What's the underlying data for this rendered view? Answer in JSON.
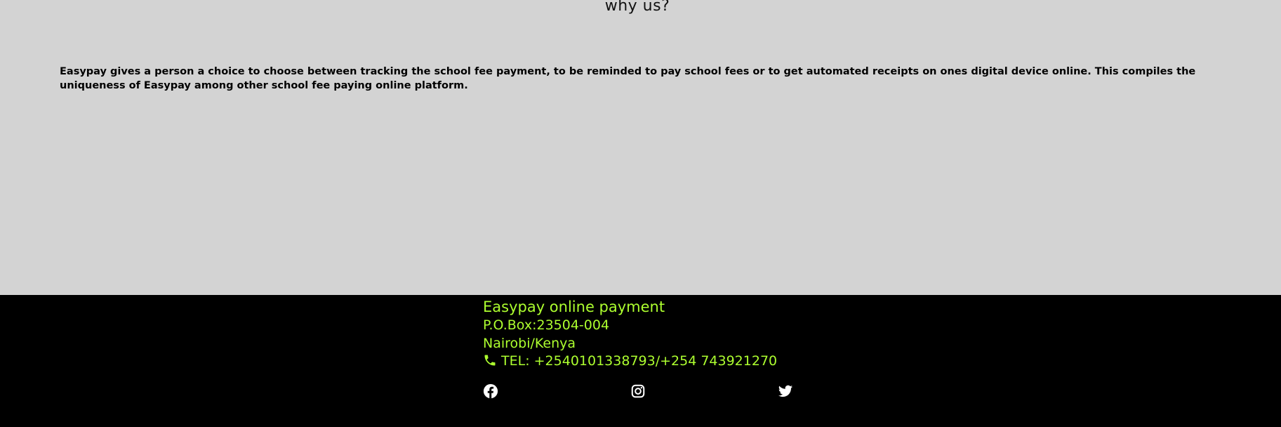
{
  "why": {
    "title": "why us?",
    "text": "Easypay gives a person a choice to choose between tracking the school fee payment, to be reminded to pay school fees or to get automated receipts on ones digital device online. This compiles the uniqueness of Easypay among other school fee paying online platform."
  },
  "footer": {
    "title": "Easypay online payment",
    "po_box": "P.O.Box:23504-004",
    "location": "Nairobi/Kenya",
    "phone": "TEL: +2540101338793/+254 743921270",
    "phone_icon": "phone-icon",
    "socials": [
      {
        "name": "facebook",
        "icon": "facebook-icon"
      },
      {
        "name": "instagram",
        "icon": "instagram-icon"
      },
      {
        "name": "twitter",
        "icon": "twitter-icon"
      }
    ]
  },
  "colors": {
    "section_background": "#d3d3d3",
    "footer_background": "#000000",
    "footer_text": "#adff2f",
    "social_icons": "#ffffff"
  }
}
